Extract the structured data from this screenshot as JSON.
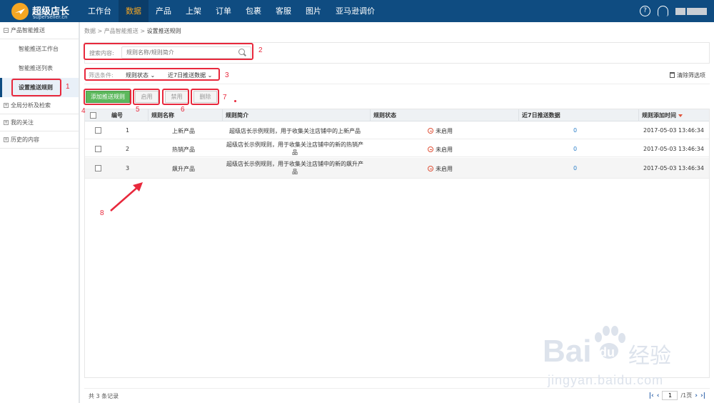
{
  "app": {
    "logo_title": "超级店长",
    "logo_sub": "superseller.cn",
    "nav": [
      "工作台",
      "数据",
      "产品",
      "上架",
      "订单",
      "包裹",
      "客服",
      "图片",
      "亚马逊调价"
    ],
    "active_nav": "数据"
  },
  "sidebar": {
    "group1": "产品智能推送",
    "items": [
      "智能推送工作台",
      "智能推送列表",
      "设置推送规则"
    ],
    "group2": "全局分析及检索",
    "group3": "我的关注",
    "group4": "历史的内容"
  },
  "breadcrumb": {
    "part1": "数据 > 产品智能推送 > ",
    "current": "设置推送规则"
  },
  "search": {
    "label": "搜索内容:",
    "placeholder": "规则名称/规则简介"
  },
  "filter": {
    "label": "筛选条件:",
    "dropdown1": "规则状态 ⌄",
    "dropdown2": "近7日推送数据 ⌄",
    "clear": "清除筛选项"
  },
  "toolbar": {
    "add": "添加推送规则",
    "enable": "启用",
    "disable": "禁用",
    "delete": "删除"
  },
  "table": {
    "headers": [
      "编号",
      "规则名称",
      "规则简介",
      "规则状态",
      "近7日推送数据",
      "规则添加时间"
    ],
    "rows": [
      {
        "id": "1",
        "name": "上新产品",
        "desc": "超级店长示例规则，用于收集关注店铺中的上新产品",
        "status": "未启用",
        "push": "0",
        "time": "2017-05-03 13:46:34"
      },
      {
        "id": "2",
        "name": "热销产品",
        "desc": "超级店长示例规则，用于收集关注店铺中的新的热销产品",
        "status": "未启用",
        "push": "0",
        "time": "2017-05-03 13:46:34"
      },
      {
        "id": "3",
        "name": "飙升产品",
        "desc": "超级店长示例规则，用于收集关注店铺中的新的飙升产品",
        "status": "未启用",
        "push": "0",
        "time": "2017-05-03 13:46:34"
      }
    ]
  },
  "footer": {
    "count": "共 3 条记录",
    "page": "1",
    "total": "/1页"
  },
  "annotations": [
    "1",
    "2",
    "3",
    "4",
    "5",
    "6",
    "7",
    "8"
  ],
  "watermark": {
    "main": "Bai",
    "du": "du",
    "cn": "经验",
    "url": "jingyan.baidu.com"
  },
  "colors": {
    "topbar": "#0f4c81",
    "active_nav": "#f5a623",
    "primary_button": "#5cb85c",
    "annotation": "#e8283c"
  }
}
